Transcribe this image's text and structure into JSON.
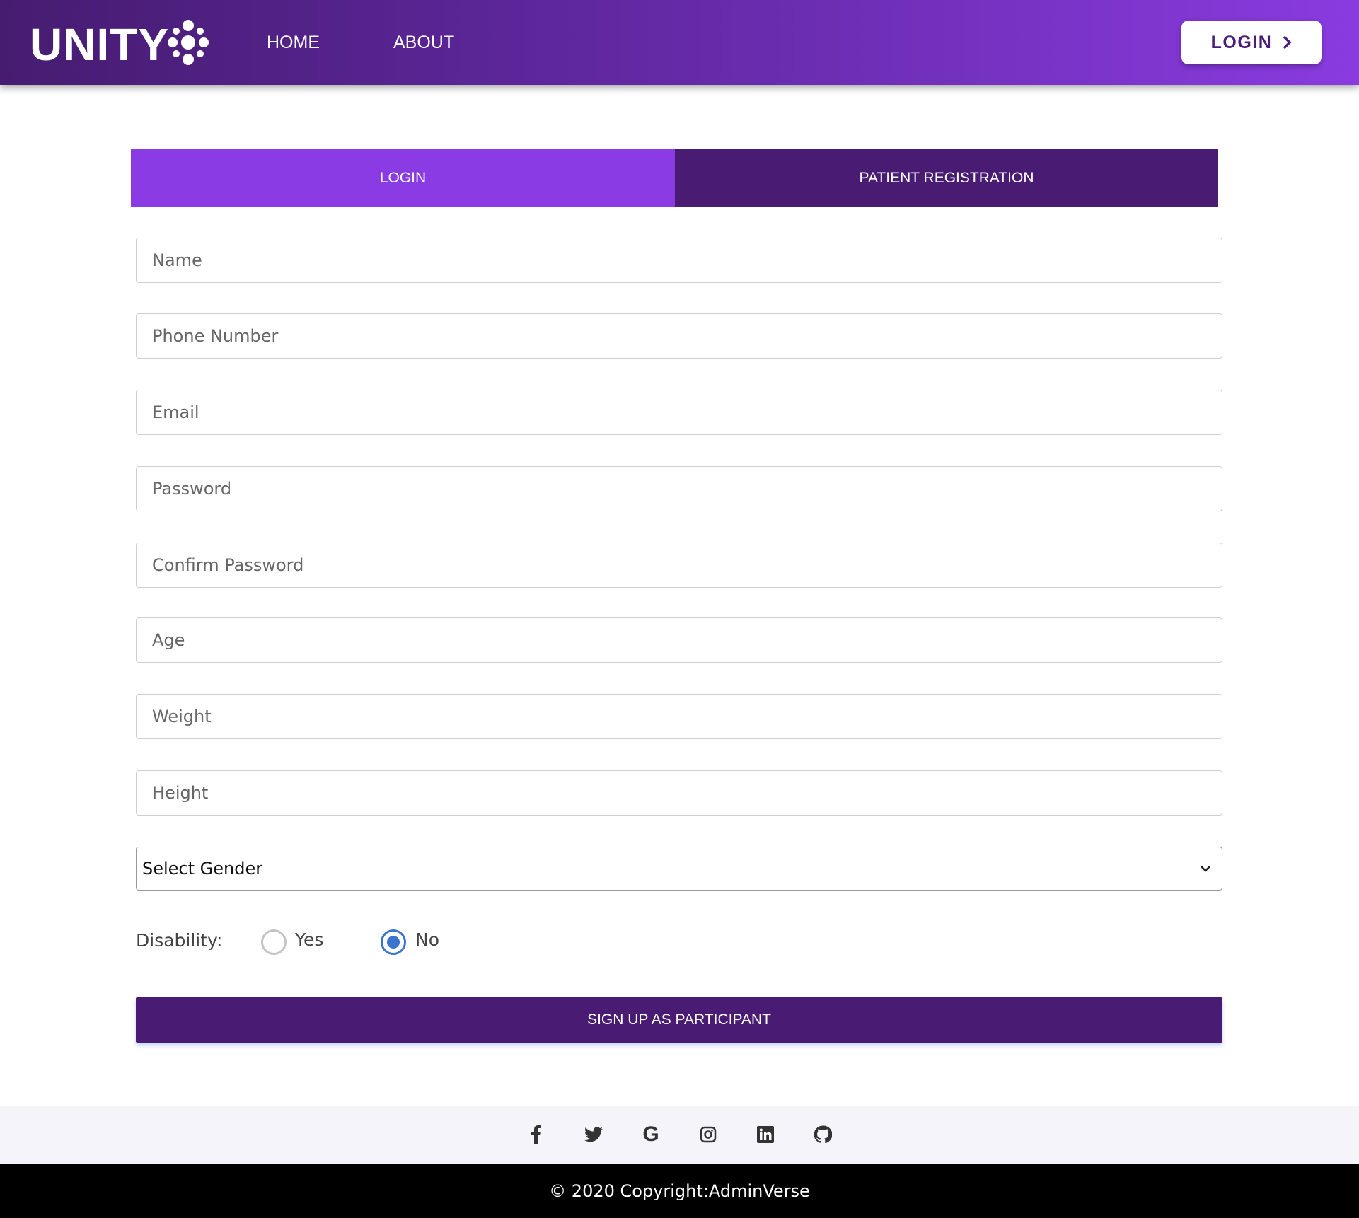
{
  "header": {
    "logo": "UNITY",
    "nav": [
      {
        "label": "HOME"
      },
      {
        "label": "ABOUT"
      }
    ],
    "login_button": "LOGIN"
  },
  "tabs": [
    {
      "label": "LOGIN",
      "color": "#8a3be3"
    },
    {
      "label": "PATIENT REGISTRATION",
      "color": "#4a1b73"
    }
  ],
  "form": {
    "fields": [
      {
        "placeholder": "Name"
      },
      {
        "placeholder": "Phone Number"
      },
      {
        "placeholder": "Email"
      },
      {
        "placeholder": "Password"
      },
      {
        "placeholder": "Confirm Password"
      },
      {
        "placeholder": "Age"
      },
      {
        "placeholder": "Weight"
      },
      {
        "placeholder": "Height"
      }
    ],
    "gender_select": "Select Gender",
    "disability_label": "Disability:",
    "disability_options": [
      {
        "label": "Yes",
        "selected": false
      },
      {
        "label": "No",
        "selected": true
      }
    ],
    "submit": "SIGN UP AS PARTICIPANT"
  },
  "footer": {
    "social_icons": [
      "facebook-icon",
      "twitter-icon",
      "google-icon",
      "instagram-icon",
      "linkedin-icon",
      "github-icon"
    ],
    "copyright": "© 2020 Copyright:AdminVerse"
  }
}
